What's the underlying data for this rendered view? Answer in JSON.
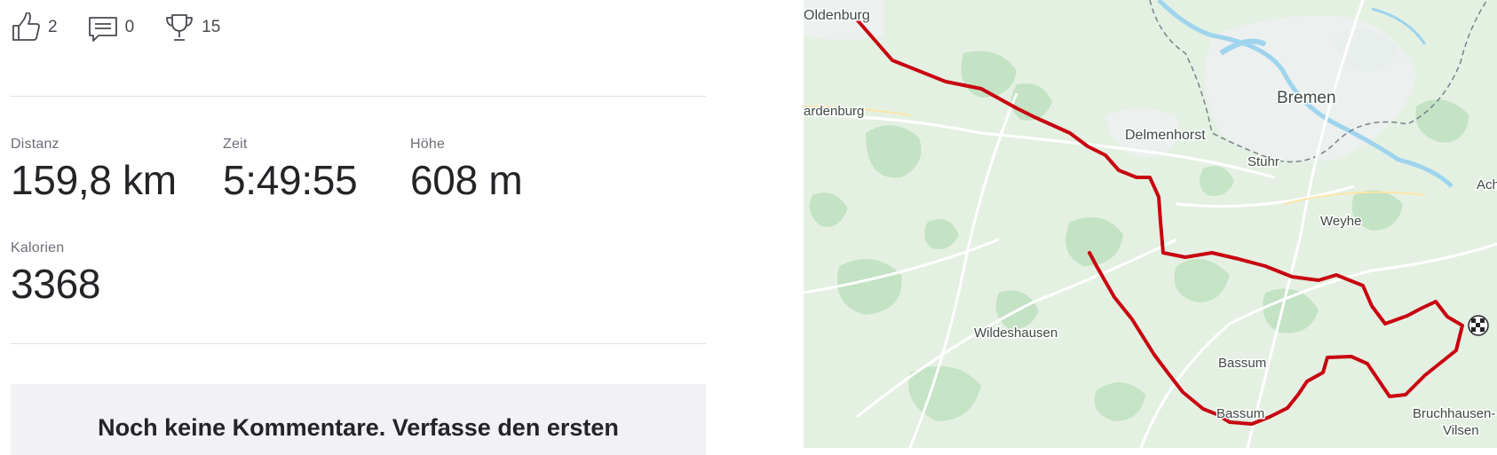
{
  "actions": {
    "kudos": {
      "icon": "thumbs-up-icon",
      "count": "2"
    },
    "comments": {
      "icon": "comment-icon",
      "count": "0"
    },
    "achievements": {
      "icon": "trophy-icon",
      "count": "15"
    }
  },
  "stats": [
    {
      "label": "Distanz",
      "value": "159,8 km"
    },
    {
      "label": "Zeit",
      "value": "5:49:55"
    },
    {
      "label": "Höhe",
      "value": "608 m"
    },
    {
      "label": "Kalorien",
      "value": "3368"
    }
  ],
  "comments_section": {
    "empty_message": "Noch keine Kommentare. Verfasse den ersten"
  },
  "map": {
    "route_color": "#c8000f",
    "labels": {
      "oldenburg": "Oldenburg",
      "bremen": "Bremen",
      "hardenburg": "ardenburg",
      "delmenhorst": "Delmenhorst",
      "stuhr": "Stuhr",
      "achim": "Ach",
      "weyhe": "Weyhe",
      "wildeshausen": "Wildeshausen",
      "bassum1": "Bassum",
      "bassum2": "Bassum",
      "bruchhausen1": "Bruchhausen-",
      "bruchhausen2": "Vilsen"
    }
  }
}
